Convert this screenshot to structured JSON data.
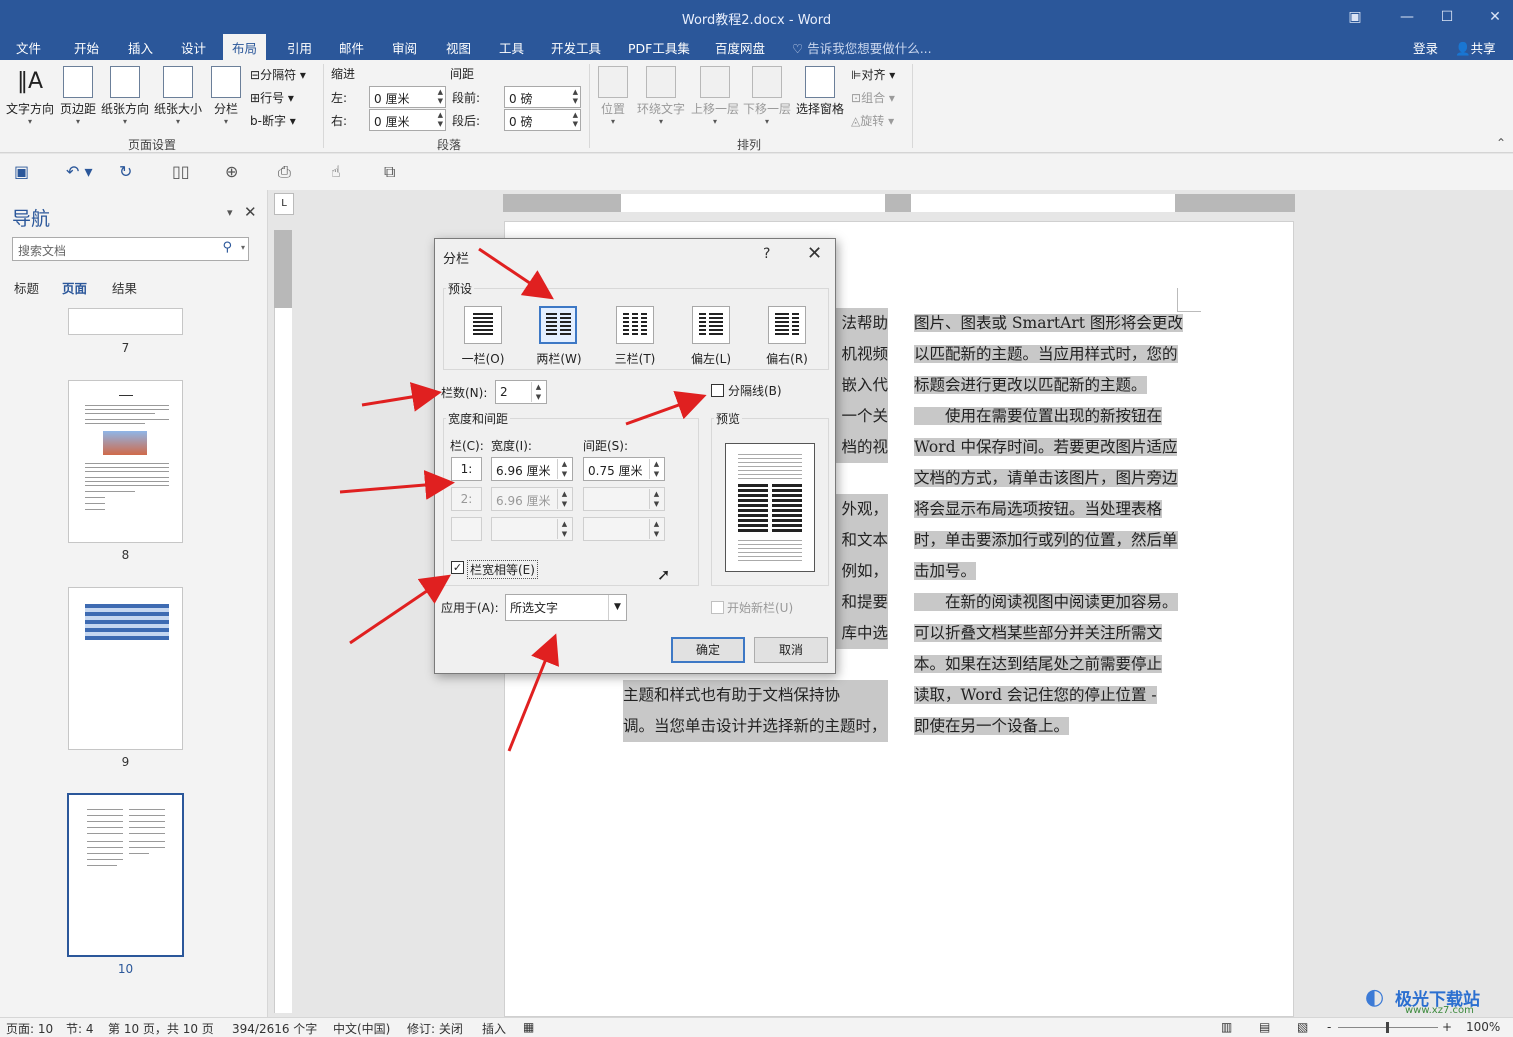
{
  "window": {
    "title": "Word教程2.docx - Word"
  },
  "tabs": [
    "文件",
    "开始",
    "插入",
    "设计",
    "布局",
    "引用",
    "邮件",
    "审阅",
    "视图",
    "工具",
    "开发工具",
    "PDF工具集",
    "百度网盘"
  ],
  "active_tab": "布局",
  "tell_me": "告诉我您想要做什么...",
  "account": {
    "login": "登录",
    "share": "共享"
  },
  "ribbon": {
    "page_setup": {
      "label": "页面设置",
      "buttons": [
        "文字方向",
        "页边距",
        "纸张方向",
        "纸张大小",
        "分栏"
      ],
      "small": [
        "分隔符",
        "行号",
        "断字"
      ]
    },
    "paragraph": {
      "label": "段落",
      "indent_label": "缩进",
      "spacing_label": "间距",
      "left_label": "左:",
      "left_value": "0 厘米",
      "right_label": "右:",
      "right_value": "0 厘米",
      "before_label": "段前:",
      "before_value": "0 磅",
      "after_label": "段后:",
      "after_value": "0 磅"
    },
    "arrange": {
      "label": "排列",
      "buttons": [
        "位置",
        "环绕文字",
        "上移一层",
        "下移一层",
        "选择窗格"
      ],
      "small": [
        "对齐",
        "组合",
        "旋转"
      ]
    }
  },
  "nav": {
    "title": "导航",
    "search_placeholder": "搜索文档",
    "tabs": [
      "标题",
      "页面",
      "结果"
    ],
    "active_tab": "页面",
    "pages": [
      "7",
      "8",
      "9",
      "10"
    ]
  },
  "document": {
    "left_col": [
      {
        "text": "法帮助",
        "hl": true
      },
      {
        "text": "机视频",
        "hl": true
      },
      {
        "text": "嵌入代",
        "hl": true
      },
      {
        "text": "一个关",
        "hl": true
      },
      {
        "text": "档的视",
        "hl": true
      },
      {
        "text": "",
        "hl": false
      },
      {
        "text": "外观，",
        "hl": true
      },
      {
        "text": "和文本",
        "hl": true
      },
      {
        "text": "例如，",
        "hl": true
      },
      {
        "text": "和提要",
        "hl": true
      },
      {
        "text": "库中选",
        "hl": true
      },
      {
        "text": "",
        "hl": false
      },
      {
        "text": "主题和样式也有助于文档保持协",
        "hl": true
      },
      {
        "text": "调。当您单击设计并选择新的主题时，",
        "hl": true
      }
    ],
    "right_col": [
      "图片、图表或 SmartArt 图形将会更改",
      "以匹配新的主题。当应用样式时，您的",
      "标题会进行更改以匹配新的主题。",
      "　　使用在需要位置出现的新按钮在",
      "Word 中保存时间。若要更改图片适应",
      "文档的方式，请单击该图片，图片旁边",
      "将会显示布局选项按钮。当处理表格",
      "时，单击要添加行或列的位置，然后单",
      "击加号。",
      "　　在新的阅读视图中阅读更加容易。",
      "可以折叠文档某些部分并关注所需文",
      "本。如果在达到结尾处之前需要停止",
      "读取，Word 会记住您的停止位置 -",
      "即使在另一个设备上。"
    ]
  },
  "dialog": {
    "title": "分栏",
    "help": "?",
    "presets_label": "预设",
    "presets": [
      "一栏(O)",
      "两栏(W)",
      "三栏(T)",
      "偏左(L)",
      "偏右(R)"
    ],
    "selected_preset": "两栏(W)",
    "num_cols_label": "栏数(N):",
    "num_cols": "2",
    "line_between_label": "分隔线(B)",
    "line_between_checked": false,
    "width_spacing_label": "宽度和间距",
    "col_header": "栏(C):",
    "width_header": "宽度(I):",
    "spacing_header": "间距(S):",
    "rows": [
      {
        "col": "1:",
        "width": "6.96 厘米",
        "spacing": "0.75 厘米",
        "enabled": true
      },
      {
        "col": "2:",
        "width": "6.96 厘米",
        "spacing": "",
        "enabled": false
      },
      {
        "col": "",
        "width": "",
        "spacing": "",
        "enabled": false
      }
    ],
    "equal_width_label": "栏宽相等(E)",
    "equal_width_checked": true,
    "preview_label": "预览",
    "apply_to_label": "应用于(A):",
    "apply_to_value": "所选文字",
    "new_column_label": "开始新栏(U)",
    "ok": "确定",
    "cancel": "取消"
  },
  "status": {
    "page": "页面: 10",
    "section": "节: 4",
    "page_of": "第 10 页，共 10 页",
    "words": "394/2616 个字",
    "language": "中文(中国)",
    "track": "修订: 关闭",
    "mode": "插入",
    "zoom": "100%"
  },
  "watermark": {
    "text": "极光下载站",
    "url": "www.xz7.com"
  }
}
